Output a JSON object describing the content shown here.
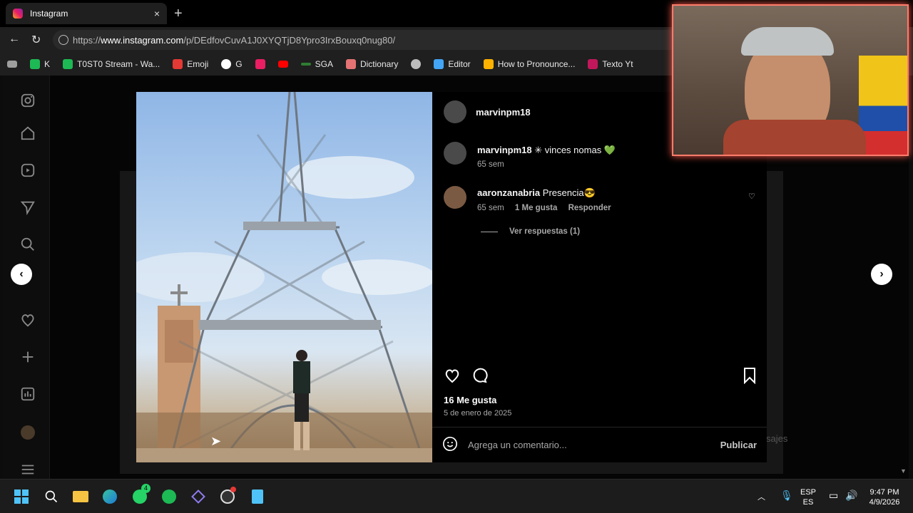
{
  "browser": {
    "tab_title": "Instagram",
    "tab_close": "×",
    "new_tab": "+",
    "url_prefix": "https://",
    "url_host": "www.instagram.com",
    "url_path": "/p/DEdfovCuvA1J0XYQTjD8Ypro3IrxBouxq0nug80/",
    "bookmarks": [
      {
        "label": "K",
        "color": "#1db954"
      },
      {
        "label": "T0ST0 Stream - Wa...",
        "color": "#1db954"
      },
      {
        "label": "Emoji",
        "color": "#e53935"
      },
      {
        "label": "G",
        "color": "#ffffff"
      },
      {
        "label": "",
        "color": "#e91e63"
      },
      {
        "label": "",
        "color": "#ff0000"
      },
      {
        "label": "SGA",
        "color": "#2e7d32"
      },
      {
        "label": "Dictionary",
        "color": "#e57373"
      },
      {
        "label": "",
        "color": "#bdbdbd"
      },
      {
        "label": "Editor",
        "color": "#42a5f5"
      },
      {
        "label": "How to Pronounce...",
        "color": "#ffb300"
      },
      {
        "label": "Texto Yt",
        "color": "#c2185b"
      }
    ]
  },
  "post": {
    "author": "marvinpm18",
    "caption_user": "marvinpm18",
    "caption_text": " ✳ vinces nomas 💚",
    "caption_time": "65 sem",
    "comment_user": "aaronzanabria",
    "comment_text": " Presencia😎",
    "comment_time": "65 sem",
    "comment_likes": "1 Me gusta",
    "comment_reply": "Responder",
    "view_replies": "Ver respuestas (1)",
    "likes": "16 Me gusta",
    "date": "5 de enero de 2025",
    "comment_placeholder": "Agrega un comentario...",
    "publish": "Publicar"
  },
  "background_hint": "sajes",
  "taskbar": {
    "whatsapp_badge": "4",
    "lang_top": "ESP",
    "lang_bottom": "ES",
    "time": "9:47 PM",
    "date": "4/9/2026"
  }
}
